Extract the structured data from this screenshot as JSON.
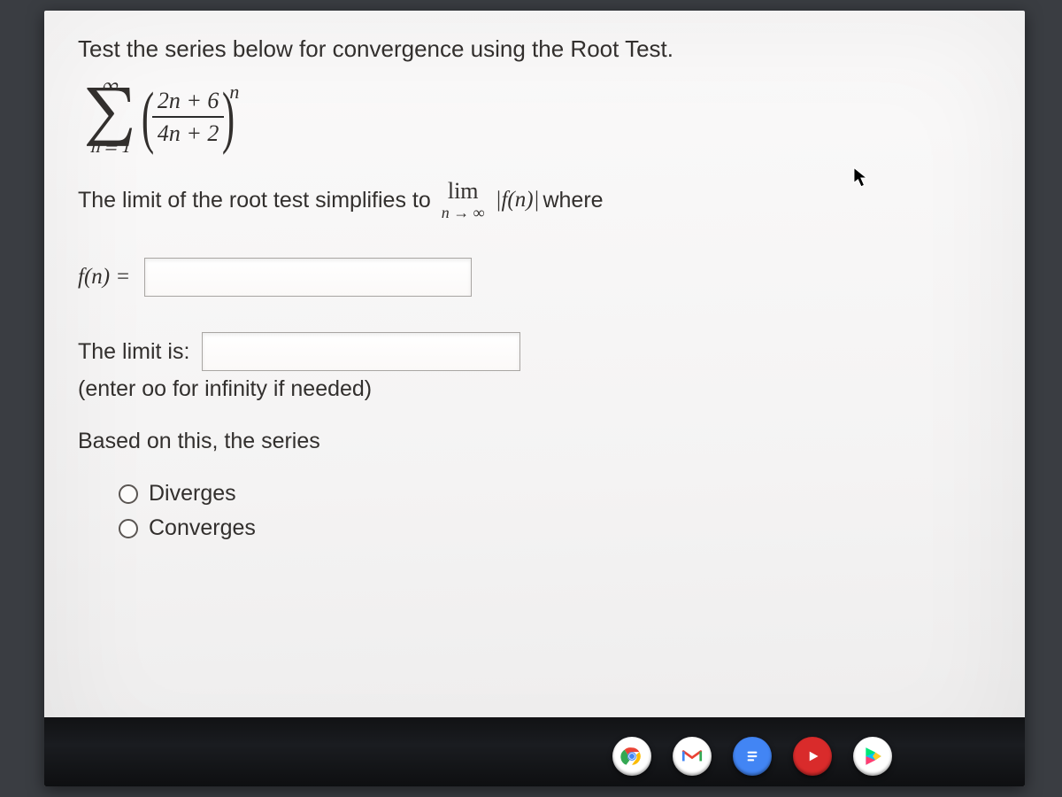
{
  "prompt": "Test the series below for convergence using the Root Test.",
  "series": {
    "upper": "∞",
    "lower": "n = 1",
    "numerator": "2n + 6",
    "denominator": "4n + 2",
    "exponent": "n"
  },
  "limit_sentence": {
    "part1": "The limit of the root test simplifies to",
    "lim_top": "lim",
    "lim_bot": "n → ∞",
    "absfn": "|f(n)|",
    "part2": "where"
  },
  "fn_label": "f(n) =",
  "fn_value": "",
  "limit_is_label": "The limit is:",
  "limit_value": "",
  "hint": "(enter oo for infinity if needed)",
  "based": "Based on this, the series",
  "options": {
    "diverges": "Diverges",
    "converges": "Converges"
  },
  "shelf_icons": [
    "chrome-icon",
    "gmail-icon",
    "docs-icon",
    "youtube-icon",
    "play-icon"
  ]
}
